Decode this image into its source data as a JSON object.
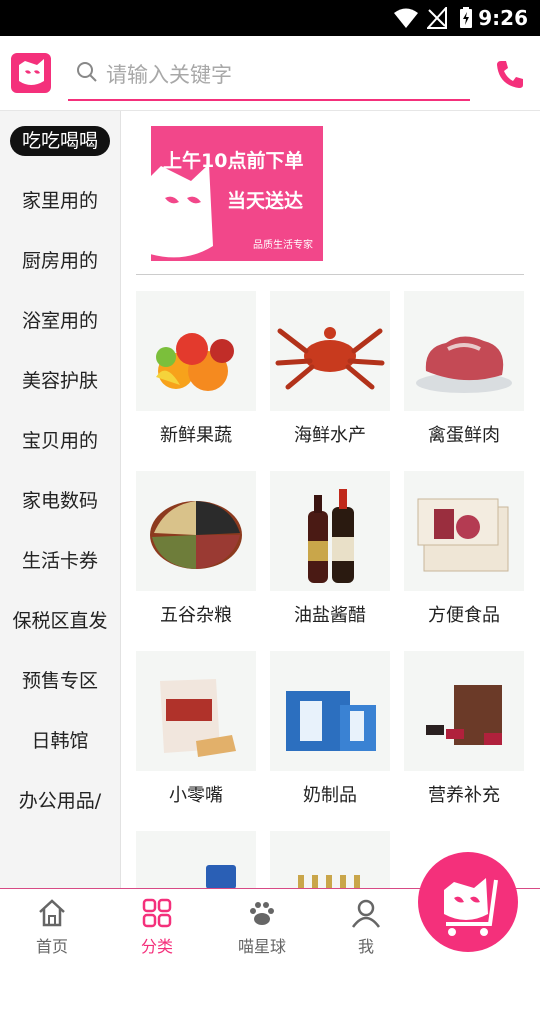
{
  "status_bar": {
    "time": "9:26"
  },
  "search": {
    "placeholder": "请输入关键字"
  },
  "sidebar": {
    "items": [
      {
        "label": "吃吃喝喝",
        "active": true
      },
      {
        "label": "家里用的"
      },
      {
        "label": "厨房用的"
      },
      {
        "label": "浴室用的"
      },
      {
        "label": "美容护肤"
      },
      {
        "label": "宝贝用的"
      },
      {
        "label": "家电数码"
      },
      {
        "label": "生活卡券"
      },
      {
        "label": "保税区直发"
      },
      {
        "label": "预售专区"
      },
      {
        "label": "日韩馆"
      },
      {
        "label": "办公用品/"
      }
    ]
  },
  "banner": {
    "line1": "上午10点前下单",
    "line2": "当天送达",
    "brand": "品质生活专家"
  },
  "categories": [
    {
      "label": "新鲜果蔬",
      "icon": "fruit-vegetables-image"
    },
    {
      "label": "海鲜水产",
      "icon": "crab-image"
    },
    {
      "label": "禽蛋鲜肉",
      "icon": "meat-image"
    },
    {
      "label": "五谷杂粮",
      "icon": "grains-image"
    },
    {
      "label": "油盐酱醋",
      "icon": "sauce-bottles-image"
    },
    {
      "label": "方便食品",
      "icon": "packaged-food-image"
    },
    {
      "label": "小零嘴",
      "icon": "snack-bag-image"
    },
    {
      "label": "奶制品",
      "icon": "milk-box-image"
    },
    {
      "label": "营养补充",
      "icon": "supplement-box-image"
    }
  ],
  "bottom_nav": {
    "items": [
      {
        "label": "首页",
        "icon": "home-icon"
      },
      {
        "label": "分类",
        "icon": "category-grid-icon",
        "active": true
      },
      {
        "label": "喵星球",
        "icon": "paw-icon"
      },
      {
        "label": "我",
        "icon": "user-icon"
      }
    ]
  },
  "colors": {
    "accent": "#f4307b",
    "active_side_bg": "#111111"
  }
}
